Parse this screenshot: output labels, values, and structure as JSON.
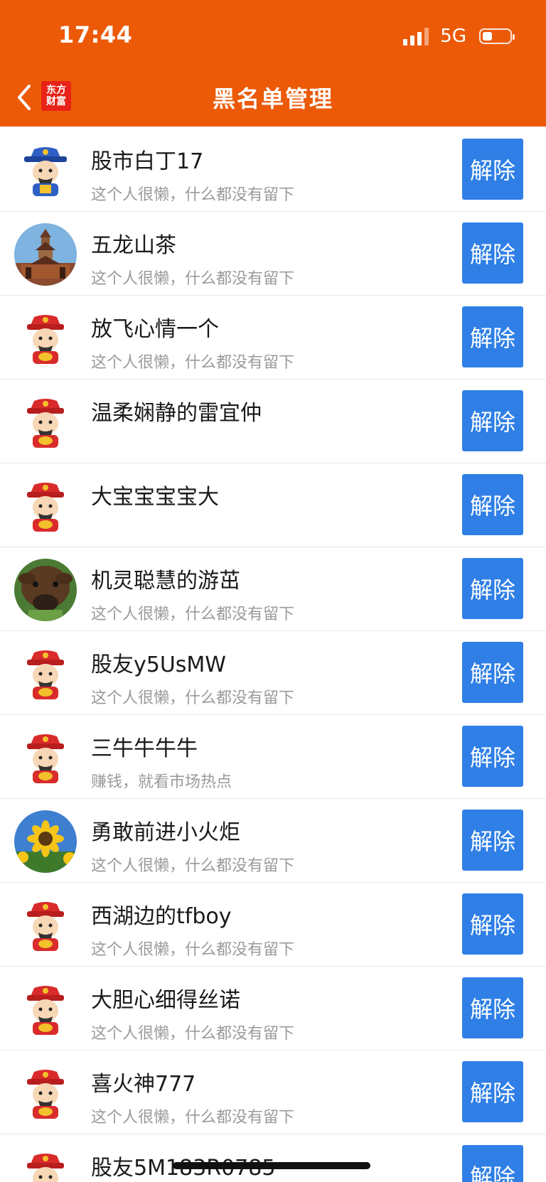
{
  "status_bar": {
    "time": "17:44",
    "network": "5G"
  },
  "header": {
    "title": "黑名单管理",
    "logo_line1": "东方",
    "logo_line2": "财富",
    "back_icon": "chevron-left-icon"
  },
  "unblock_label": "解除",
  "blocked_users": [
    {
      "name": "股市白丁17",
      "signature": "这个人很懒，什么都没有留下",
      "avatar": "caishen-blue"
    },
    {
      "name": "五龙山茶",
      "signature": "这个人很懒，什么都没有留下",
      "avatar": "photo-pagoda"
    },
    {
      "name": "放飞心情一个",
      "signature": "这个人很懒，什么都没有留下",
      "avatar": "caishen-red"
    },
    {
      "name": "温柔娴静的雷宜仲",
      "signature": "",
      "avatar": "caishen-red"
    },
    {
      "name": "大宝宝宝宝大",
      "signature": "",
      "avatar": "caishen-red"
    },
    {
      "name": "机灵聪慧的游茁",
      "signature": "这个人很懒，什么都没有留下",
      "avatar": "photo-cow"
    },
    {
      "name": "股友y5UsMW",
      "signature": "这个人很懒，什么都没有留下",
      "avatar": "caishen-red"
    },
    {
      "name": "三牛牛牛牛",
      "signature": "赚钱，就看市场热点",
      "avatar": "caishen-red"
    },
    {
      "name": "勇敢前进小火炬",
      "signature": "这个人很懒，什么都没有留下",
      "avatar": "photo-sunflower"
    },
    {
      "name": "西湖边的tfboy",
      "signature": "这个人很懒，什么都没有留下",
      "avatar": "caishen-red"
    },
    {
      "name": "大胆心细得丝诺",
      "signature": "这个人很懒，什么都没有留下",
      "avatar": "caishen-red"
    },
    {
      "name": "喜火神777",
      "signature": "这个人很懒，什么都没有留下",
      "avatar": "caishen-red"
    },
    {
      "name": "股友5M183R0785",
      "signature": "",
      "avatar": "caishen-red"
    }
  ],
  "colors": {
    "header_bg": "#EC5A08",
    "button_bg": "#2F7FE6",
    "signature_text": "#9A9A9A"
  }
}
